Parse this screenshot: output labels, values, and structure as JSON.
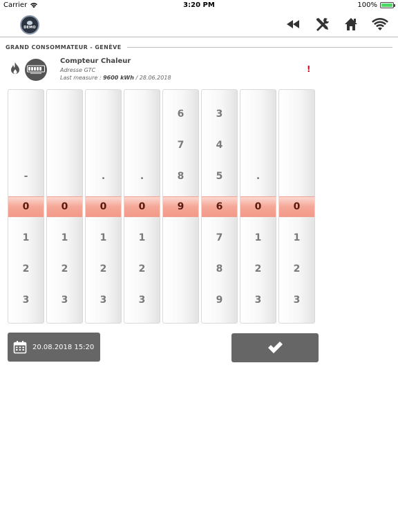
{
  "status_bar": {
    "carrier": "Carrier",
    "time": "3:20 PM",
    "battery": "100%",
    "battery_level": 1.0
  },
  "nav": {
    "logo_text": "DEMO",
    "icons": [
      "rewind-icon",
      "tools-icon",
      "home-icon",
      "wifi-icon"
    ]
  },
  "section": {
    "title": "GRAND CONSOMMATEUR - GENÈVE"
  },
  "meter": {
    "title": "Compteur Chaleur",
    "address": "Adresse GTC",
    "last_measure_label": "Last measure :",
    "last_measure_value": "9600 kWh",
    "last_measure_date": "/ 28.06.2018",
    "alert": "!"
  },
  "digit_columns": [
    {
      "above": [
        "",
        "",
        "-"
      ],
      "selected": "0",
      "below": [
        "1",
        "2",
        "3"
      ]
    },
    {
      "above": [
        "",
        "",
        ""
      ],
      "selected": "0",
      "below": [
        "1",
        "2",
        "3"
      ]
    },
    {
      "above": [
        "",
        "",
        "."
      ],
      "selected": "0",
      "below": [
        "1",
        "2",
        "3"
      ]
    },
    {
      "above": [
        "",
        "",
        "."
      ],
      "selected": "0",
      "below": [
        "1",
        "2",
        "3"
      ]
    },
    {
      "above": [
        "6",
        "7",
        "8"
      ],
      "selected": "9",
      "below": [
        "",
        "",
        ""
      ]
    },
    {
      "above": [
        "3",
        "4",
        "5"
      ],
      "selected": "6",
      "below": [
        "7",
        "8",
        "9"
      ]
    },
    {
      "above": [
        "",
        "",
        "."
      ],
      "selected": "0",
      "below": [
        "1",
        "2",
        "3"
      ]
    },
    {
      "above": [
        "",
        "",
        ""
      ],
      "selected": "0",
      "below": [
        "1",
        "2",
        "3"
      ]
    }
  ],
  "date_button": {
    "label": "20.08.2018 15:20"
  },
  "colors": {
    "button_bg": "#666666",
    "selected_row": "#f5a797",
    "alert": "#d0021b"
  }
}
